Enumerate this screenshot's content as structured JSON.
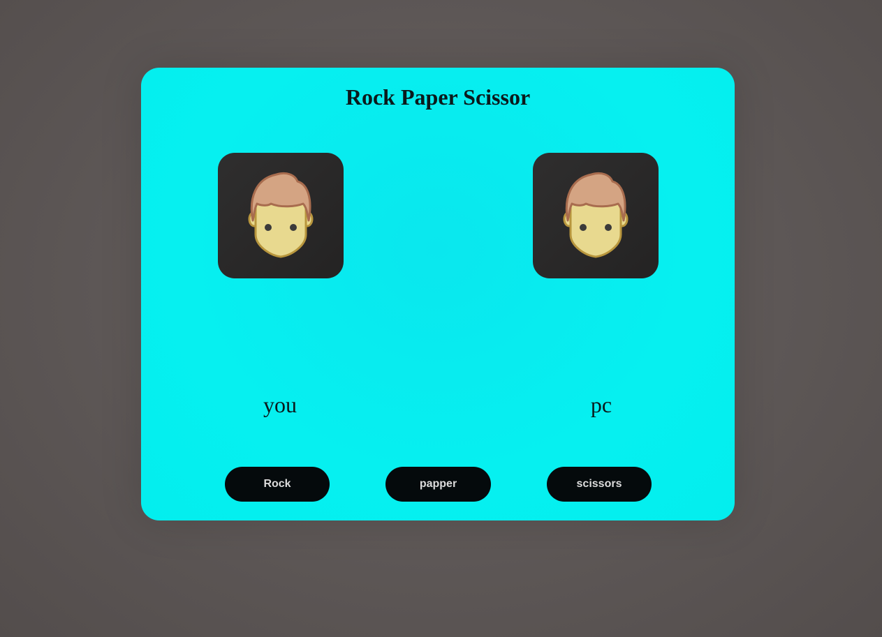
{
  "game": {
    "title": "Rock Paper Scissor"
  },
  "players": {
    "you": {
      "label": "you",
      "avatar_icon": "male-avatar-icon"
    },
    "pc": {
      "label": "pc",
      "avatar_icon": "male-avatar-icon"
    }
  },
  "controls": {
    "rock_label": "Rock",
    "paper_label": "papper",
    "scissors_label": "scissors"
  },
  "colors": {
    "page_background": "#5e5857",
    "card_background": "#06f0f0",
    "avatar_box": "#2a2929",
    "button_background": "#050a0c",
    "button_text": "#dcdcdc",
    "hair": "#d4a483",
    "skin": "#e8d98f"
  }
}
